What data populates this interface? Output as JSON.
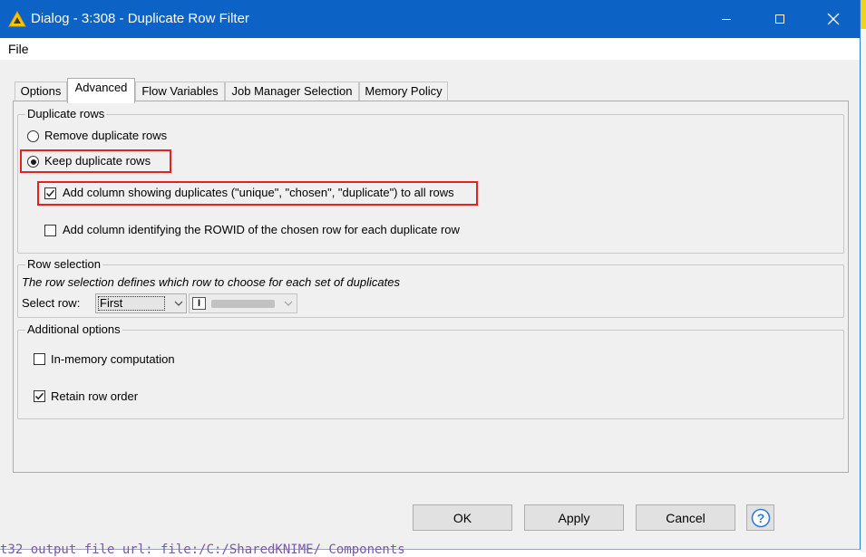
{
  "window": {
    "title": "Dialog - 3:308 - Duplicate Row Filter",
    "accent_color": "#0d62c6",
    "controls": [
      "minimize-icon",
      "maximize-icon",
      "close-icon"
    ]
  },
  "menu": {
    "items": [
      "File"
    ]
  },
  "tabs": [
    {
      "label": "Options",
      "active": false
    },
    {
      "label": "Advanced",
      "active": true
    },
    {
      "label": "Flow Variables",
      "active": false
    },
    {
      "label": "Job Manager Selection",
      "active": false
    },
    {
      "label": "Memory Policy",
      "active": false
    }
  ],
  "duplicate_rows": {
    "legend": "Duplicate rows",
    "remove_label": "Remove duplicate rows",
    "keep_label": "Keep duplicate rows",
    "selected": "keep",
    "add_column_label": "Add column showing duplicates (\"unique\", \"chosen\", \"duplicate\") to all rows",
    "add_column_checked": true,
    "add_rowid_label": "Add column identifying the ROWID of the chosen row for each duplicate row",
    "add_rowid_checked": false
  },
  "row_selection": {
    "legend": "Row selection",
    "description": "The row selection defines which row to choose for each set of duplicates",
    "select_label": "Select row:",
    "select_value": "First",
    "column_type_icon": "I",
    "column_value_blurred": true
  },
  "additional_options": {
    "legend": "Additional options",
    "in_memory_label": "In-memory computation",
    "in_memory_checked": false,
    "retain_order_label": "Retain row order",
    "retain_order_checked": true
  },
  "buttons": {
    "ok": "OK",
    "apply": "Apply",
    "cancel": "Cancel",
    "help_icon": "help-icon"
  },
  "background_text": "t32   output file url: file:/C:/SharedKNIME/ Components",
  "highlight_color": "#e52222"
}
